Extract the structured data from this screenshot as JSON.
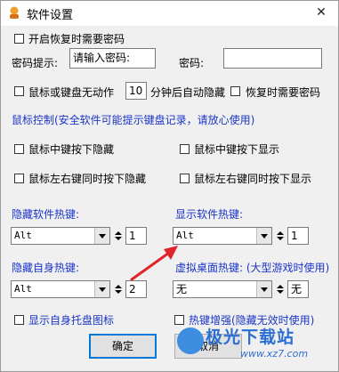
{
  "window": {
    "title": "软件设置",
    "close_glyph": "✕"
  },
  "options": {
    "password_on_restore_label": "开启恢复时需要密码",
    "hint_label": "密码提示:",
    "hint_value": "请输入密码:",
    "password_label": "密码:",
    "password_value": "",
    "idle_hide_label": "鼠标或键盘无动作",
    "idle_minutes": "10",
    "idle_suffix_label": "分钟后自动隐藏",
    "restore_password_label": "恢复时需要密码"
  },
  "mouse": {
    "heading": "鼠标控制(安全软件可能提示键盘记录，请放心使用)",
    "middle_hide": "鼠标中键按下隐藏",
    "middle_show": "鼠标中键按下显示",
    "both_hide": "鼠标左右键同时按下隐藏",
    "both_show": "鼠标左右键同时按下显示"
  },
  "hotkeys": {
    "hide_label": "隐藏软件热键:",
    "hide_mod": "Alt",
    "hide_key": "1",
    "show_label": "显示软件热键:",
    "show_mod": "Alt",
    "show_key": "1",
    "self_hide_label": "隐藏自身热键:",
    "self_hide_mod": "Alt",
    "self_hide_key": "2",
    "vdesk_label": "虚拟桌面热键: (大型游戏时使用)",
    "vdesk_mod": "无",
    "vdesk_key": "无"
  },
  "footer": {
    "tray_icon_label": "显示自身托盘图标",
    "hotkey_boost_label": "热键增强(隐藏无效时使用)",
    "ok_label": "确定",
    "cancel_label": "取消"
  },
  "watermark": {
    "brand": "极光下载站",
    "url": "www.xz7.com"
  },
  "colors": {
    "heading_blue": "#1a35c8",
    "arrow_red": "#e0242a",
    "watermark_blue": "#2d6ed3"
  }
}
